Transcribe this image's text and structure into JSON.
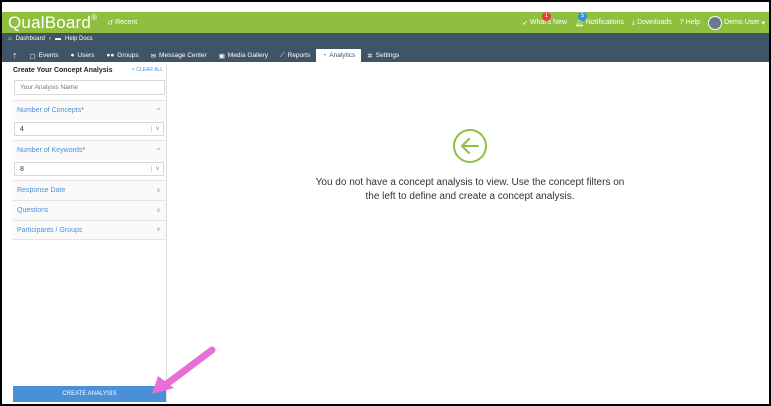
{
  "app": {
    "logo": "QualBoard",
    "logo_mark": "®",
    "recent_label": "Recent"
  },
  "topbar": {
    "whats_new": "What's New",
    "whats_new_badge": "1",
    "notifications": "Notifications",
    "notifications_badge": "5",
    "downloads": "Downloads",
    "help": "Help",
    "user": "Demo User"
  },
  "breadcrumb": {
    "items": [
      "Dashboard",
      "Help Docs"
    ]
  },
  "nav": {
    "tabs": [
      {
        "label": "Events",
        "icon": "calendar-icon"
      },
      {
        "label": "Users",
        "icon": "user-icon"
      },
      {
        "label": "Groups",
        "icon": "group-icon"
      },
      {
        "label": "Message Center",
        "icon": "envelope-icon"
      },
      {
        "label": "Media Gallery",
        "icon": "gallery-icon"
      },
      {
        "label": "Reports",
        "icon": "chart-icon"
      },
      {
        "label": "Analytics",
        "icon": "pie-icon",
        "active": true
      },
      {
        "label": "Settings",
        "icon": "gear-icon"
      }
    ]
  },
  "sidebar": {
    "title": "Create Your Concept Analysis",
    "clear_all": "× CLEAR ALL",
    "name_placeholder": "Your Analysis Name",
    "concepts_label": "Number of Concepts",
    "concepts_value": "4",
    "keywords_label": "Number of Keywords",
    "keywords_value": "8",
    "required_mark": "*",
    "filters": [
      "Response Date",
      "Questions",
      "Participants / Groups"
    ],
    "create_button": "CREATE ANALYSIS"
  },
  "main": {
    "empty_message_line1": "You do not have a concept analysis to view. Use the concept filters on",
    "empty_message_line2": "the left to define and create a concept analysis."
  },
  "colors": {
    "brand_green": "#8fbf3f",
    "nav_dark": "#3f5466",
    "link_blue": "#4a90d9",
    "pointer_pink": "#e86ed8"
  }
}
